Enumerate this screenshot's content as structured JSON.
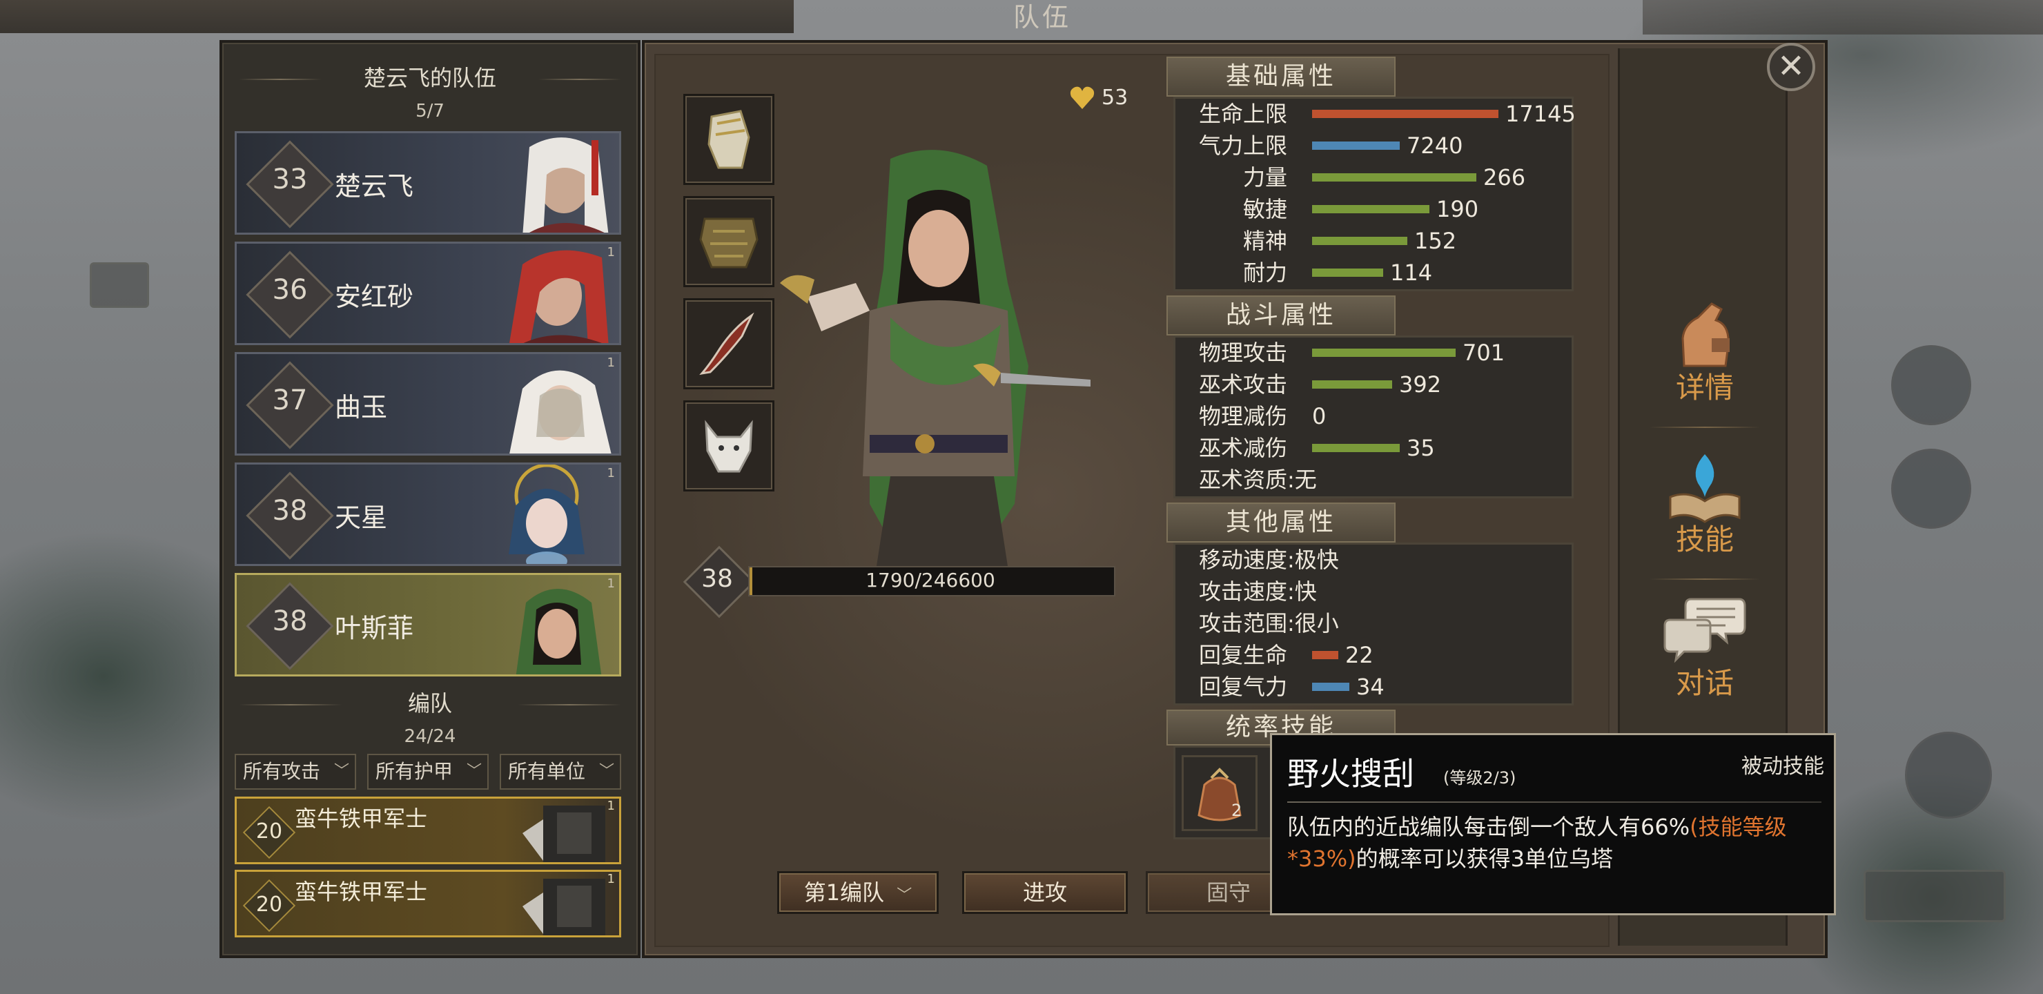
{
  "window_title": "队伍",
  "party": {
    "title": "楚云飞的队伍",
    "count": "5/7",
    "members": [
      {
        "level": "33",
        "name": "楚云飞",
        "badge": ""
      },
      {
        "level": "36",
        "name": "安红砂",
        "badge": "1"
      },
      {
        "level": "37",
        "name": "曲玉",
        "badge": "1"
      },
      {
        "level": "38",
        "name": "天星",
        "badge": "1"
      },
      {
        "level": "38",
        "name": "叶斯菲",
        "badge": "1",
        "selected": true
      }
    ]
  },
  "formation": {
    "title": "编队",
    "count": "24/24",
    "filters": [
      "所有攻击",
      "所有护甲",
      "所有单位"
    ],
    "units": [
      {
        "level": "20",
        "name": "蛮牛铁甲军士",
        "badge": "1"
      },
      {
        "level": "20",
        "name": "蛮牛铁甲军士",
        "badge": "1"
      }
    ]
  },
  "character": {
    "affection": "53",
    "level": "38",
    "exp": "1790/246600",
    "exp_fraction": 0.0073,
    "equipment": [
      "gauntlet-icon",
      "armor-icon",
      "blade-icon",
      "wolf-companion-icon"
    ]
  },
  "stats": {
    "basic": {
      "header": "基础属性",
      "rows": [
        {
          "label": "生命上限",
          "value": "17145",
          "color": "#c0522f",
          "ratio": 1.0
        },
        {
          "label": "气力上限",
          "value": "7240",
          "color": "#4e87b5",
          "ratio": 0.47
        },
        {
          "label": "力量",
          "value": "266",
          "color": "#7a9a3a",
          "ratio": 0.88
        },
        {
          "label": "敏捷",
          "value": "190",
          "color": "#7a9a3a",
          "ratio": 0.63
        },
        {
          "label": "精神",
          "value": "152",
          "color": "#7a9a3a",
          "ratio": 0.51
        },
        {
          "label": "耐力",
          "value": "114",
          "color": "#7a9a3a",
          "ratio": 0.38
        }
      ]
    },
    "combat": {
      "header": "战斗属性",
      "rows": [
        {
          "label": "物理攻击",
          "value": "701",
          "color": "#7a9a3a",
          "ratio": 0.77
        },
        {
          "label": "巫术攻击",
          "value": "392",
          "color": "#7a9a3a",
          "ratio": 0.43
        },
        {
          "label": "物理减伤",
          "value": "0",
          "color": "#7a9a3a",
          "ratio": 0
        },
        {
          "label": "巫术减伤",
          "value": "35",
          "color": "#7a9a3a",
          "ratio": 0.47
        },
        {
          "label": "巫术资质",
          "text": ":无"
        }
      ]
    },
    "other": {
      "header": "其他属性",
      "rows": [
        {
          "label": "移动速度",
          "text": ":极快"
        },
        {
          "label": "攻击速度",
          "text": ":快"
        },
        {
          "label": "攻击范围",
          "text": ":很小"
        },
        {
          "label": "回复生命",
          "value": "22",
          "color": "#c0522f",
          "ratio": 0.14
        },
        {
          "label": "回复气力",
          "value": "34",
          "color": "#4e87b5",
          "ratio": 0.2
        }
      ]
    },
    "command_header": "统率技能",
    "command_skill_level": "2"
  },
  "sidebar": {
    "details_label": "详情",
    "skills_label": "技能",
    "dialogue_label": "对话"
  },
  "actions": {
    "formation_select": "第1编队",
    "attack": "进攻",
    "hold": "固守"
  },
  "tooltip": {
    "name": "野火搜刮",
    "level": "(等级2/3)",
    "type": "被动技能",
    "desc_a": "队伍内的近战编队每击倒一个敌人有66%",
    "desc_highlight": "(技能等级*33%)",
    "desc_b": "的概率可以获得3单位乌塔"
  },
  "colors": {
    "accent_orange": "#d99a4a",
    "health": "#c0522f",
    "stamina": "#4e87b5",
    "attribute": "#7a9a3a",
    "highlight": "#e0742f"
  }
}
